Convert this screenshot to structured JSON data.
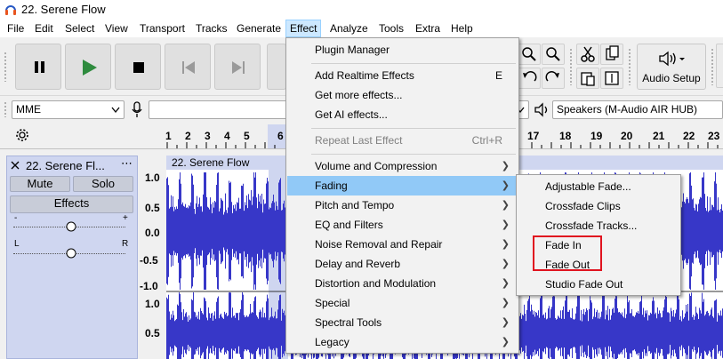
{
  "window": {
    "title": "22. Serene Flow"
  },
  "menubar": [
    "File",
    "Edit",
    "Select",
    "View",
    "Transport",
    "Tracks",
    "Generate",
    "Effect",
    "Analyze",
    "Tools",
    "Extra",
    "Help"
  ],
  "toolbar": {
    "audio_setup": "Audio Setup"
  },
  "devices": {
    "host": "MME",
    "output": "Speakers (M-Audio AIR HUB)"
  },
  "ruler": {
    "ticks": [
      "1",
      "2",
      "3",
      "4",
      "5",
      "6",
      "17",
      "18",
      "19",
      "20",
      "21",
      "22",
      "23"
    ]
  },
  "track": {
    "name": "22. Serene Fl...",
    "clip_name": "22. Serene Flow",
    "mute": "Mute",
    "solo": "Solo",
    "effects": "Effects",
    "gain_minus": "-",
    "gain_plus": "+",
    "pan_left": "L",
    "pan_right": "R",
    "scale": [
      "1.0",
      "0.5",
      "0.0",
      "-0.5",
      "-1.0",
      "1.0",
      "0.5"
    ]
  },
  "effect_menu": {
    "items": [
      {
        "label": "Plugin Manager",
        "accel": ""
      },
      {
        "label": "Add Realtime Effects",
        "accel": "E"
      },
      {
        "label": "Get more effects...",
        "accel": ""
      },
      {
        "label": "Get AI effects...",
        "accel": ""
      },
      {
        "label": "Repeat Last Effect",
        "accel": "Ctrl+R"
      },
      {
        "label": "Volume and Compression",
        "accel": ""
      },
      {
        "label": "Fading",
        "accel": ""
      },
      {
        "label": "Pitch and Tempo",
        "accel": ""
      },
      {
        "label": "EQ and Filters",
        "accel": ""
      },
      {
        "label": "Noise Removal and Repair",
        "accel": ""
      },
      {
        "label": "Delay and Reverb",
        "accel": ""
      },
      {
        "label": "Distortion and Modulation",
        "accel": ""
      },
      {
        "label": "Special",
        "accel": ""
      },
      {
        "label": "Spectral Tools",
        "accel": ""
      },
      {
        "label": "Legacy",
        "accel": ""
      }
    ]
  },
  "fading_menu": {
    "items": [
      "Adjustable Fade...",
      "Crossfade Clips",
      "Crossfade Tracks...",
      "Fade In",
      "Fade Out",
      "Studio Fade Out"
    ]
  },
  "colors": {
    "accent": "#91c9f7",
    "wave": "#3737c8",
    "highlight_box": "#e0131f"
  }
}
